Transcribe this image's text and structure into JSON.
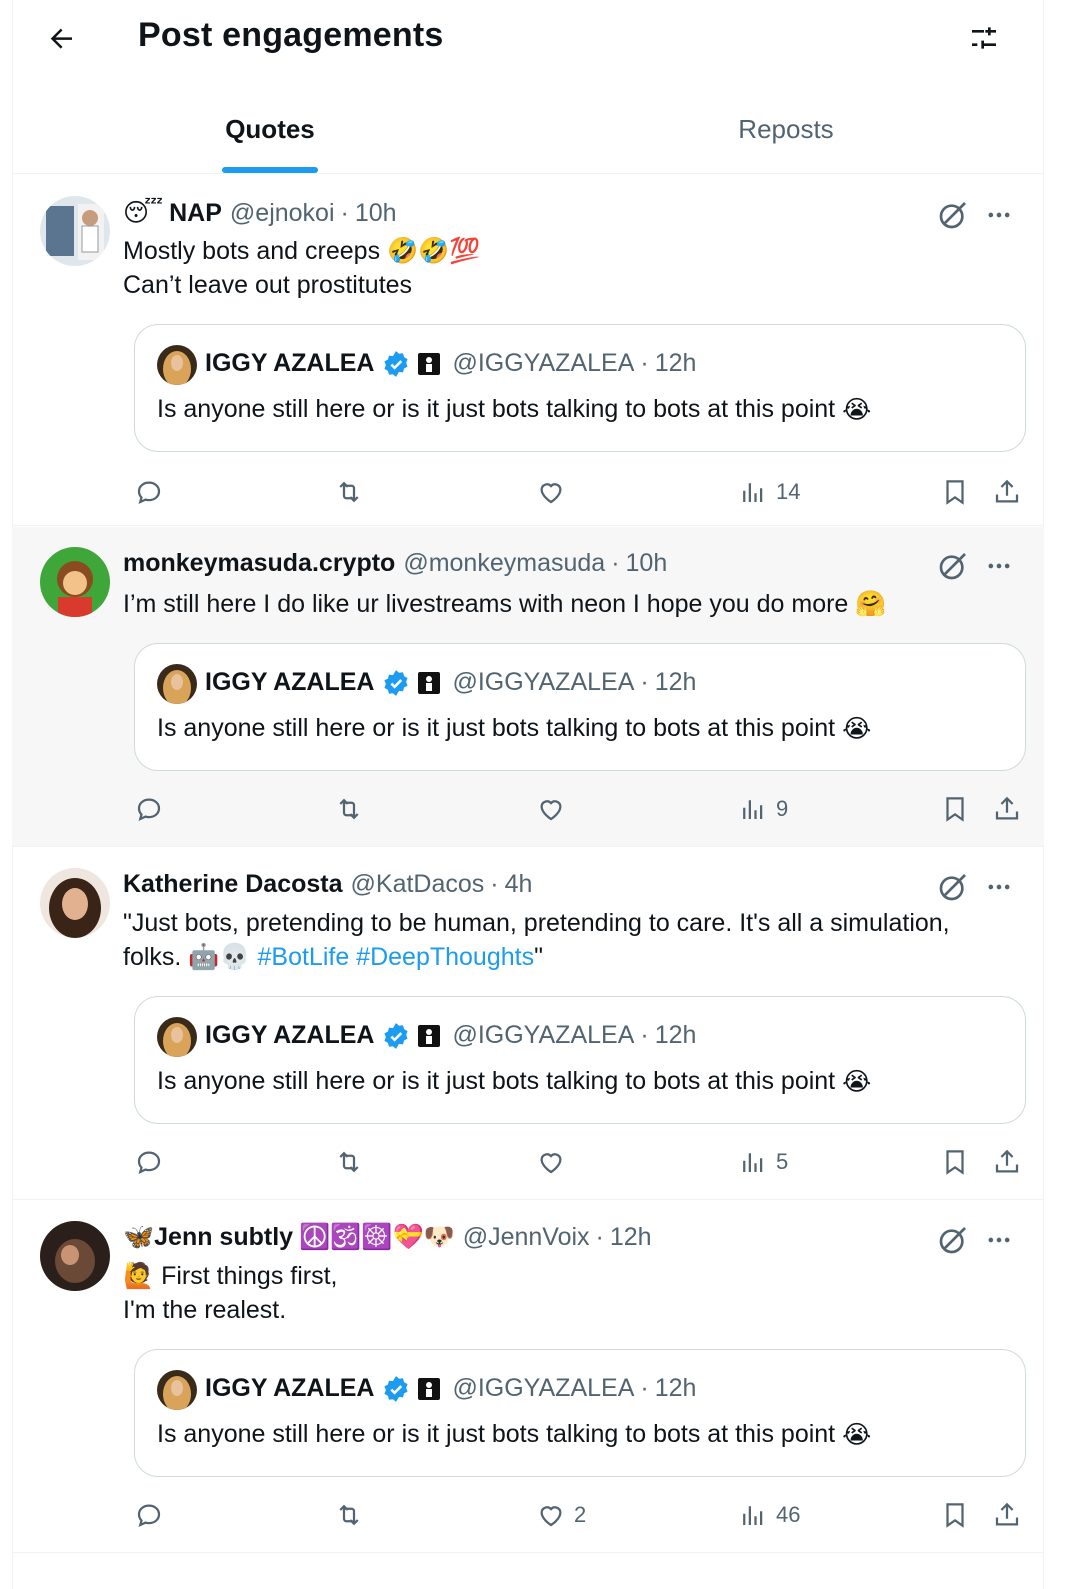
{
  "header": {
    "title": "Post engagements",
    "back_icon": "arrow-left-icon",
    "filter_icon": "sliders-icon"
  },
  "tabs": [
    {
      "label": "Quotes",
      "active": true
    },
    {
      "label": "Reposts",
      "active": false
    }
  ],
  "quoted_post": {
    "name": "IGGY AZALEA",
    "handle": "@IGGYAZALEA",
    "dot": "·",
    "time": "12h",
    "text": "Is anyone still here or is it just bots talking to bots at this point",
    "emoji": "😭"
  },
  "posts": [
    {
      "name": "NAP",
      "name_prefix_emoji": "😴",
      "handle": "@ejnokoi",
      "dot": "·",
      "time": "10h",
      "lines": [
        "Mostly bots and creeps 🤣🤣💯",
        "Can’t leave out prostitutes"
      ],
      "views": "14",
      "likes": ""
    },
    {
      "name": "monkeymasuda.crypto",
      "handle": "@monkeymasuda",
      "dot": "·",
      "time": "10h",
      "lines": [
        "I’m still here I do like ur livestreams with neon I hope  you  do  more  🤗"
      ],
      "views": "9",
      "likes": ""
    },
    {
      "name": "Katherine Dacosta",
      "handle": "@KatDacos",
      "dot": "·",
      "time": "4h",
      "line1": "\"Just bots, pretending to be human, pretending to care. It's all a simulation,",
      "line2_start": "folks. 🤖💀 ",
      "hashtags": "#BotLife #DeepThoughts",
      "line2_end": "\"",
      "views": "5",
      "likes": ""
    },
    {
      "name": "Jenn subtly",
      "name_prefix_emoji": "🦋",
      "name_suffix_emoji": "☮️🕉️☸️💝🐶",
      "handle": "@JennVoix",
      "dot": "·",
      "time": "12h",
      "lines": [
        "🙋 First things first,",
        "I'm the realest."
      ],
      "views": "46",
      "likes": "2"
    }
  ],
  "colors": {
    "accent": "#1d9bf0",
    "text": "#0f1419",
    "muted": "#536471",
    "border": "#cfd9de",
    "highlight_bg": "#f7f7f7"
  }
}
